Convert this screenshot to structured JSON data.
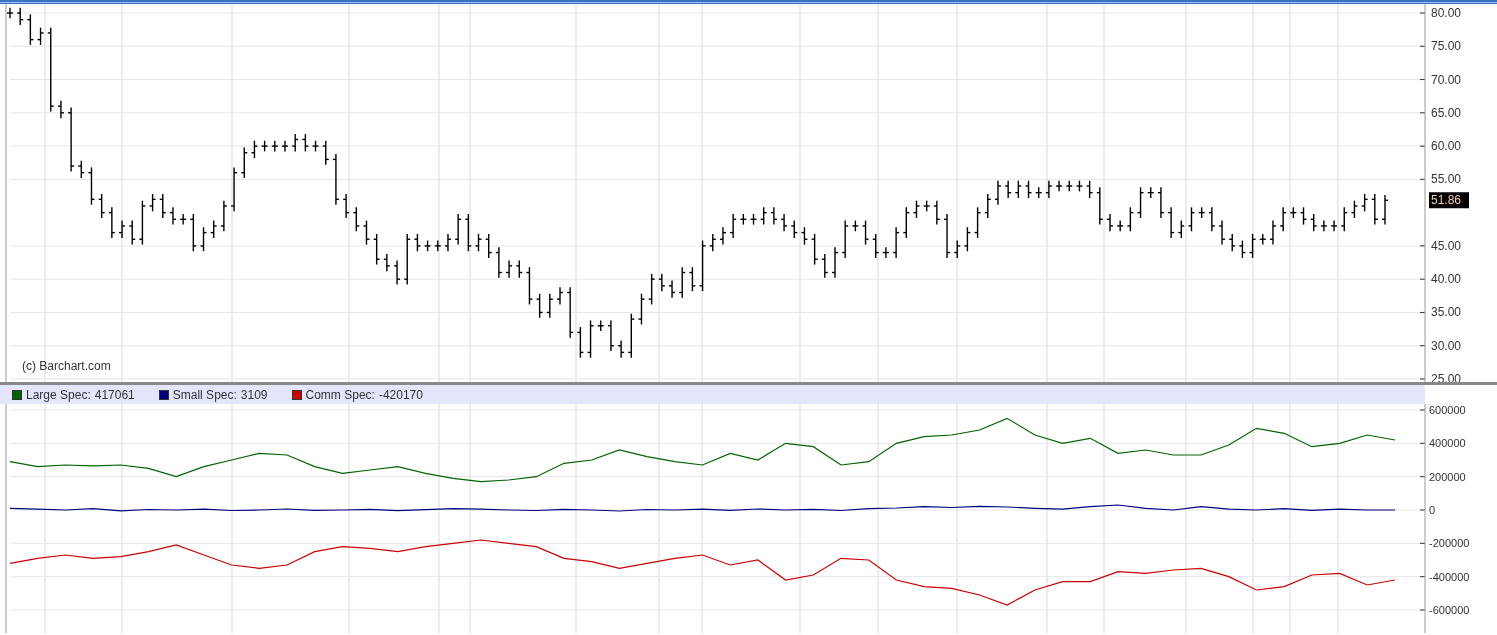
{
  "price_chart": {
    "watermark": "(c) Barchart.com",
    "last_price": "51.86",
    "axis_labels": [
      "80.00",
      "75.00",
      "70.00",
      "65.00",
      "60.00",
      "55.00",
      "45.00",
      "40.00",
      "35.00",
      "30.00",
      "25.00"
    ]
  },
  "cot_chart": {
    "legend": [
      {
        "separator": ":",
        "value": "417061"
      },
      {
        "separator": ":",
        "value": "3109"
      },
      {
        "separator": ":",
        "value": "-420170"
      }
    ],
    "chart_data": {
      "type": "line",
      "grid": true,
      "ylim": [
        -600000,
        600000
      ],
      "yticks": [
        {
          "value": 600000,
          "label": "600000"
        },
        {
          "value": 400000,
          "label": "400000"
        },
        {
          "value": 200000,
          "label": "200000"
        },
        {
          "value": 0,
          "label": "0"
        },
        {
          "value": -200000,
          "label": "-200000"
        },
        {
          "value": -400000,
          "label": "-400000"
        },
        {
          "value": -600000,
          "label": "-600000"
        }
      ],
      "series": [
        {
          "name": "Large Spec",
          "color": "#006400",
          "values": [
            290000,
            260000,
            270000,
            265000,
            270000,
            250000,
            200000,
            260000,
            300000,
            340000,
            330000,
            260000,
            220000,
            240000,
            260000,
            220000,
            190000,
            170000,
            180000,
            200000,
            280000,
            300000,
            360000,
            320000,
            290000,
            270000,
            340000,
            300000,
            400000,
            380000,
            270000,
            290000,
            400000,
            440000,
            450000,
            480000,
            550000,
            450000,
            400000,
            430000,
            340000,
            360000,
            330000,
            330000,
            390000,
            490000,
            460000,
            380000,
            400000,
            450000,
            420000
          ]
        },
        {
          "name": "Small Spec",
          "color": "#000080",
          "values": [
            10000,
            5000,
            0,
            8000,
            -5000,
            3000,
            0,
            5000,
            -3000,
            0,
            6000,
            -2000,
            0,
            4000,
            -4000,
            2000,
            8000,
            5000,
            0,
            -3000,
            4000,
            0,
            -6000,
            3000,
            0,
            5000,
            -2000,
            6000,
            0,
            4000,
            -3000,
            8000,
            12000,
            20000,
            15000,
            22000,
            18000,
            10000,
            5000,
            20000,
            30000,
            10000,
            0,
            20000,
            5000,
            0,
            8000,
            -2000,
            5000,
            0,
            0
          ]
        },
        {
          "name": "Comm Spec",
          "color": "#cc0000",
          "values": [
            -320000,
            -290000,
            -270000,
            -290000,
            -280000,
            -250000,
            -210000,
            -270000,
            -330000,
            -350000,
            -330000,
            -250000,
            -220000,
            -230000,
            -250000,
            -220000,
            -200000,
            -180000,
            -200000,
            -220000,
            -290000,
            -310000,
            -350000,
            -320000,
            -290000,
            -270000,
            -330000,
            -300000,
            -420000,
            -390000,
            -290000,
            -300000,
            -420000,
            -460000,
            -470000,
            -510000,
            -570000,
            -480000,
            -430000,
            -430000,
            -370000,
            -380000,
            -360000,
            -350000,
            -400000,
            -480000,
            -460000,
            -390000,
            -380000,
            -450000,
            -420000
          ]
        }
      ]
    }
  }
}
